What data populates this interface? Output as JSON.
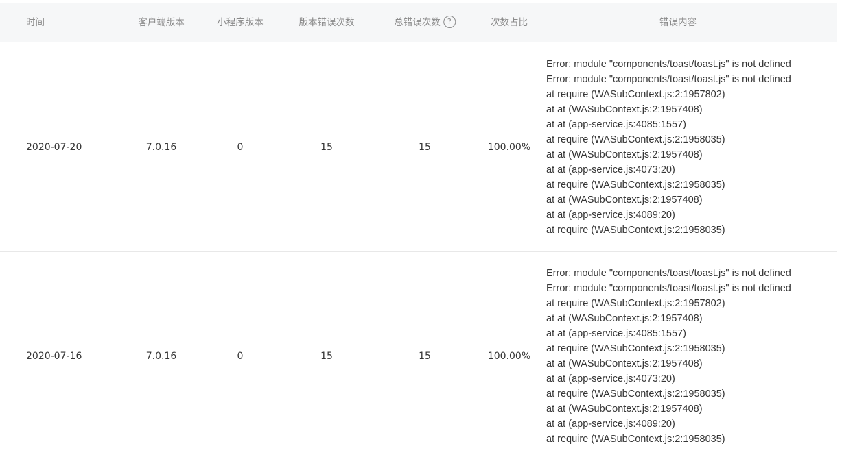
{
  "headers": {
    "time": "时间",
    "client_version": "客户端版本",
    "miniprogram_version": "小程序版本",
    "version_error_count": "版本错误次数",
    "total_error_count": "总错误次数",
    "help_glyph": "?",
    "ratio": "次数占比",
    "error_content": "错误内容"
  },
  "rows": [
    {
      "date": "2020-07-20",
      "client_version": "7.0.16",
      "miniprogram_version": "0",
      "version_error_count": "15",
      "total_error_count": "15",
      "ratio": "100.00%",
      "errors": [
        "Error: module \"components/toast/toast.js\" is not defined",
        "Error: module \"components/toast/toast.js\" is not defined",
        "at require (WASubContext.js:2:1957802)",
        "at at (WASubContext.js:2:1957408)",
        "at at (app-service.js:4085:1557)",
        "at require (WASubContext.js:2:1958035)",
        "at at (WASubContext.js:2:1957408)",
        "at at (app-service.js:4073:20)",
        "at require (WASubContext.js:2:1958035)",
        "at at (WASubContext.js:2:1957408)",
        "at at (app-service.js:4089:20)",
        "at require (WASubContext.js:2:1958035)"
      ]
    },
    {
      "date": "2020-07-16",
      "client_version": "7.0.16",
      "miniprogram_version": "0",
      "version_error_count": "15",
      "total_error_count": "15",
      "ratio": "100.00%",
      "errors": [
        "Error: module \"components/toast/toast.js\" is not defined",
        "Error: module \"components/toast/toast.js\" is not defined",
        "at require (WASubContext.js:2:1957802)",
        "at at (WASubContext.js:2:1957408)",
        "at at (app-service.js:4085:1557)",
        "at require (WASubContext.js:2:1958035)",
        "at at (WASubContext.js:2:1957408)",
        "at at (app-service.js:4073:20)",
        "at require (WASubContext.js:2:1958035)",
        "at at (WASubContext.js:2:1957408)",
        "at at (app-service.js:4089:20)",
        "at require (WASubContext.js:2:1958035)"
      ]
    }
  ]
}
